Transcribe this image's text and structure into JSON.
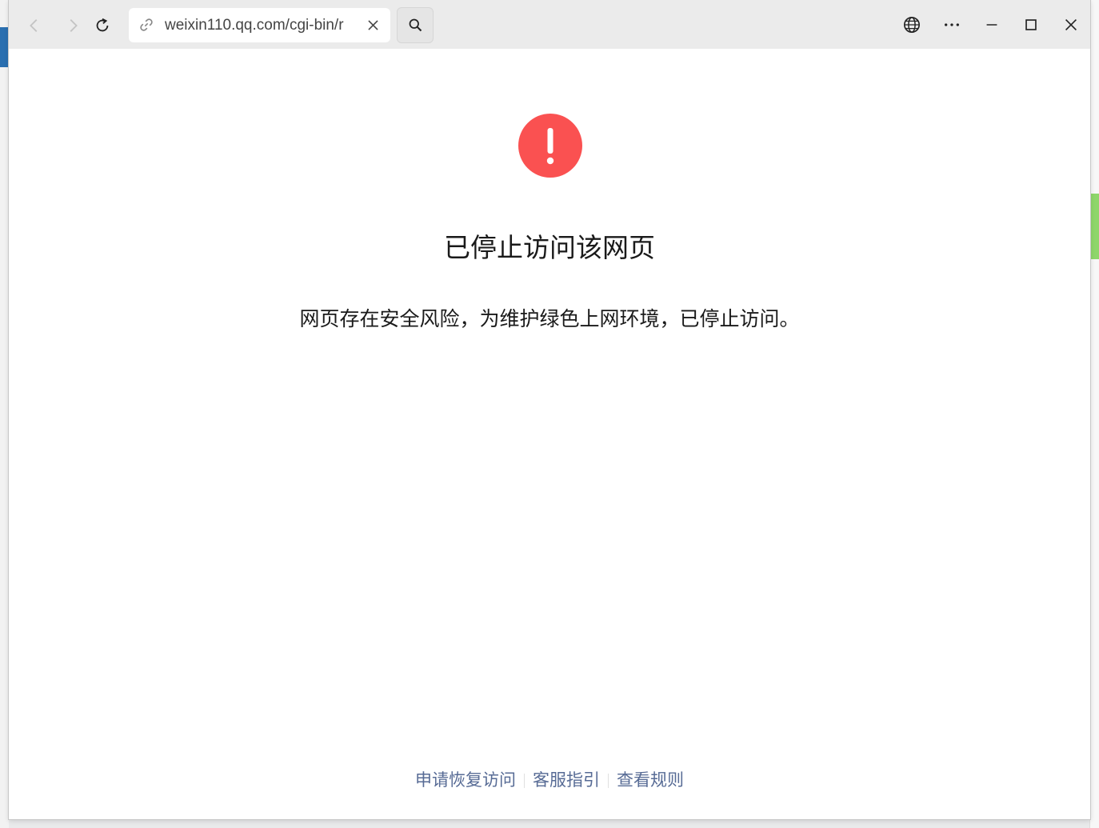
{
  "browser": {
    "address_url": "weixin110.qq.com/cgi-bin/r",
    "icons": {
      "back": "chevron-left-icon",
      "forward": "chevron-right-icon",
      "reload": "reload-icon",
      "link": "link-icon",
      "clear": "close-icon",
      "search": "search-icon",
      "translate": "globe-icon",
      "more": "more-icon",
      "minimize": "minimize-icon",
      "maximize": "maximize-icon",
      "close": "close-icon"
    }
  },
  "page": {
    "title": "已停止访问该网页",
    "description": "网页存在安全风险，为维护绿色上网环境，已停止访问。",
    "footer_links": [
      "申请恢复访问",
      "客服指引",
      "查看规则"
    ]
  },
  "colors": {
    "warning": "#fa5151",
    "link": "#576b95"
  }
}
